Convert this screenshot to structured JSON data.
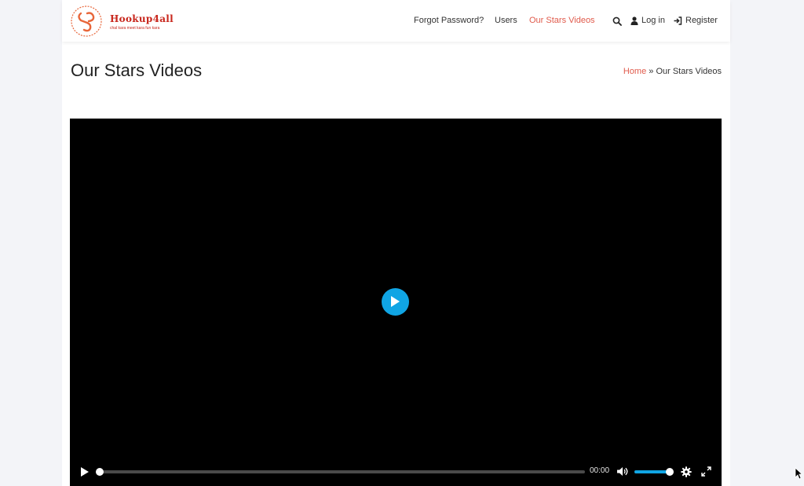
{
  "header": {
    "logo": {
      "name": "Hookup4all",
      "tagline": "chal kara meet kara fun kara",
      "ring_text": "Hookup4all"
    },
    "nav": {
      "forgot_password": "Forgot Password?",
      "users": "Users",
      "our_stars_videos": "Our Stars Videos",
      "login": "Log in",
      "register": "Register"
    },
    "active_item": "Our Stars Videos"
  },
  "page": {
    "title": "Our Stars Videos",
    "breadcrumb": {
      "home": "Home",
      "separator": "»",
      "current": "Our Stars Videos"
    }
  },
  "player": {
    "time": "00:00",
    "progress": 0,
    "volume": 1.0,
    "accent_color": "#10a5e4"
  },
  "colors": {
    "accent": "#e05a4b",
    "logo_red": "#c8261c",
    "player_accent": "#10a5e4",
    "page_bg": "#f3f4f8"
  },
  "icons": [
    "search-icon",
    "user-icon",
    "sign-in-icon",
    "play-icon",
    "volume-icon",
    "settings-icon",
    "fullscreen-icon"
  ]
}
